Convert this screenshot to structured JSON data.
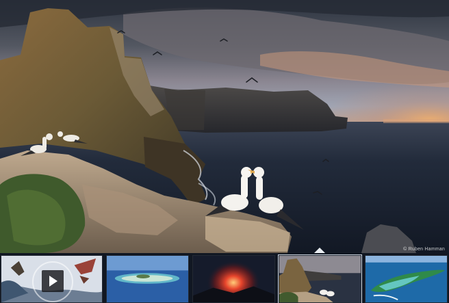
{
  "hero": {
    "image": "seabird-cliff-sunset",
    "caption": "© Ruben Hamman"
  },
  "filmstrip": {
    "thumbnails": [
      {
        "subject": "bird-flight-video",
        "has_play": true
      },
      {
        "subject": "atoll-aerial",
        "has_play": false
      },
      {
        "subject": "volcano-lava",
        "has_play": false
      },
      {
        "subject": "seabird-cliff-sunset",
        "has_play": false,
        "selected": true
      },
      {
        "subject": "island-lagoon-aerial",
        "has_play": false
      }
    ]
  },
  "colors": {
    "strip_bg": "#111722",
    "pointer": "#e9edf2",
    "sea": "#1d2636",
    "sky_warm": "#e9a06a"
  }
}
